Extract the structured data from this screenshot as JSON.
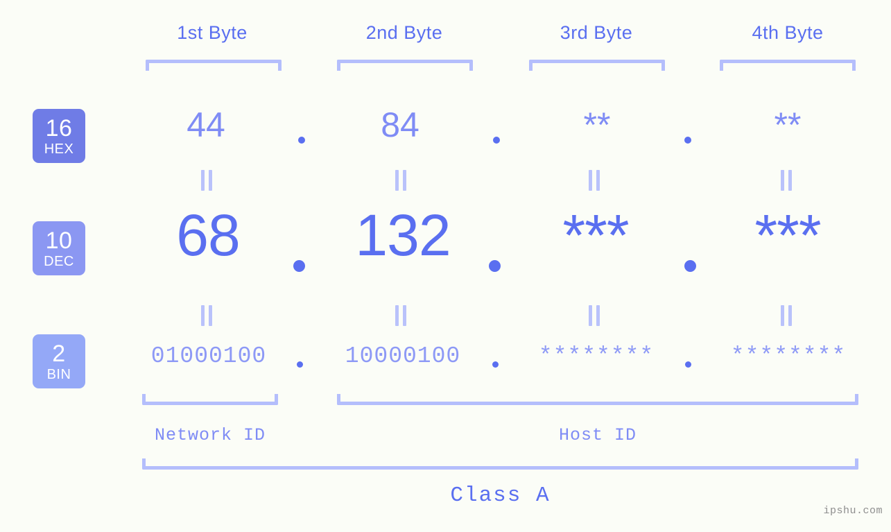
{
  "background_color": "#fbfdf7",
  "accent_colors": {
    "primary": "#5a6ff0",
    "secondary": "#7f8cf5",
    "light": "#b4befc",
    "badge_hex": "#6f7ce6",
    "badge_dec": "#8b97f2",
    "badge_bin": "#94a8f7",
    "watermark": "#8e8e8e"
  },
  "headers": [
    {
      "label": "1st Byte"
    },
    {
      "label": "2nd Byte"
    },
    {
      "label": "3rd Byte"
    },
    {
      "label": "4th Byte"
    }
  ],
  "rows": [
    {
      "radix": "16",
      "radix_label": "HEX",
      "values": [
        "44",
        "84",
        "**",
        "**"
      ],
      "separator": "."
    },
    {
      "radix": "10",
      "radix_label": "DEC",
      "values": [
        "68",
        "132",
        "***",
        "***"
      ],
      "separator": "."
    },
    {
      "radix": "2",
      "radix_label": "BIN",
      "values": [
        "01000100",
        "10000100",
        "********",
        "********"
      ],
      "separator": "."
    }
  ],
  "equals_glyph": "=",
  "sections": {
    "network_id": "Network ID",
    "host_id": "Host ID",
    "class": "Class A"
  },
  "watermark": "ipshu.com"
}
